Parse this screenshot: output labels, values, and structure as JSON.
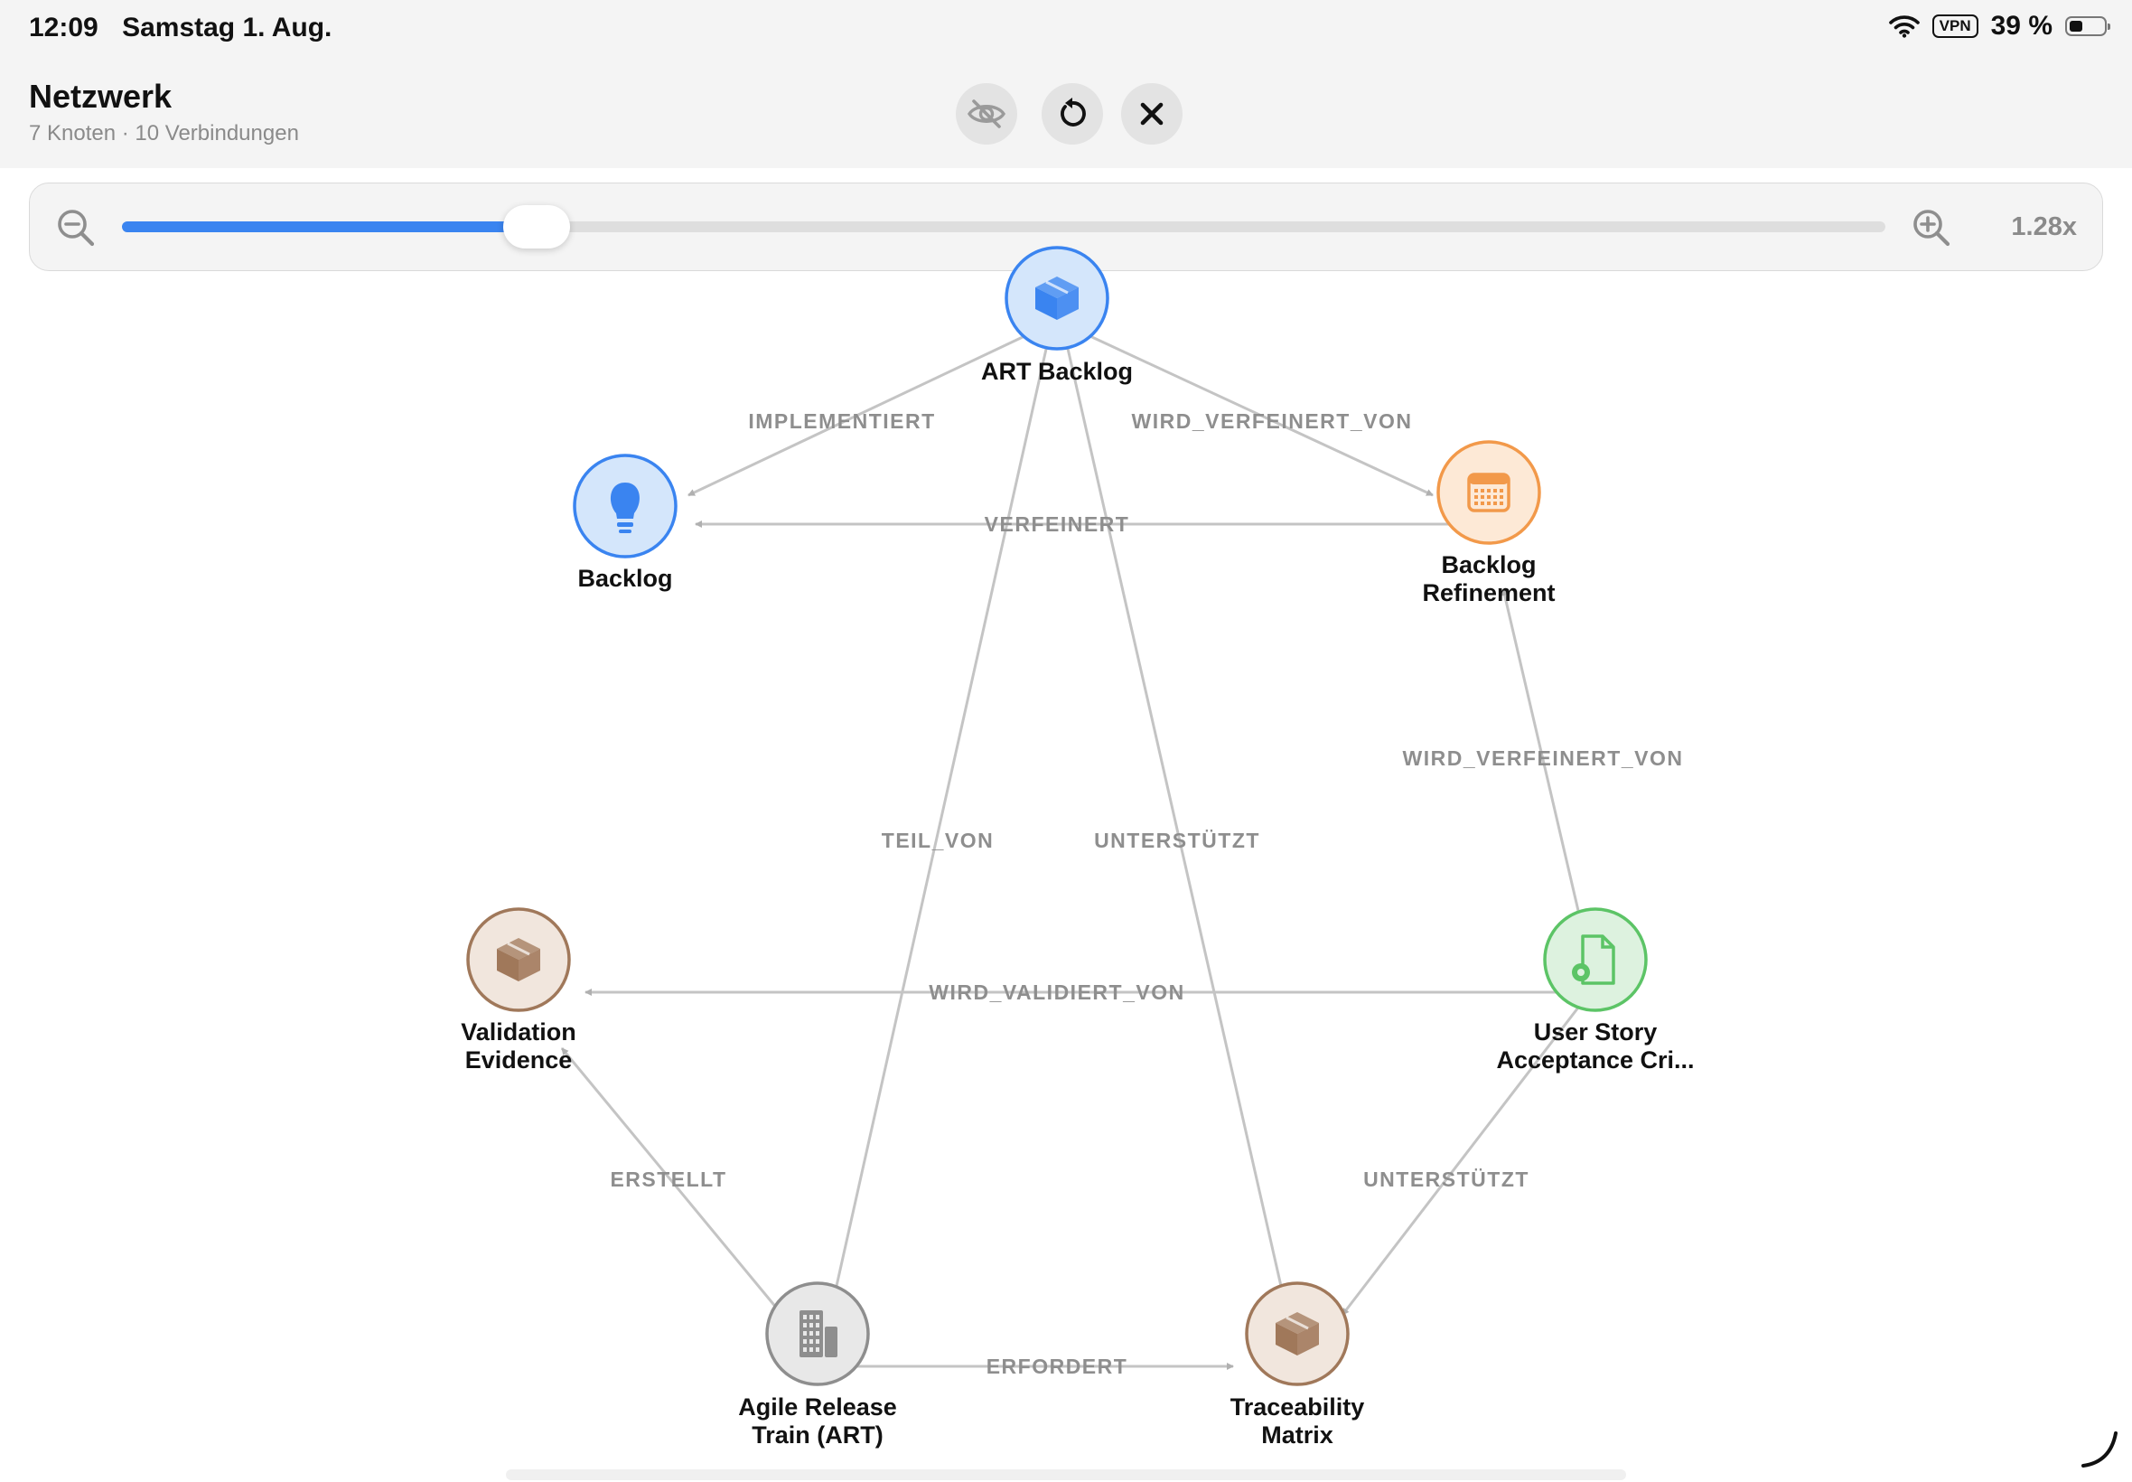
{
  "status_bar": {
    "time": "12:09",
    "date": "Samstag 1. Aug.",
    "vpn": "VPN",
    "battery": "39 %",
    "battery_level": 0.39
  },
  "header": {
    "title": "Netzwerk",
    "subtitle": "7 Knoten · 10 Verbindungen",
    "buttons": [
      "eye-slash-icon",
      "rotate-ccw-icon",
      "close-icon"
    ]
  },
  "zoom": {
    "value_label": "1.28x",
    "fraction": 0.235
  },
  "graph": {
    "nodes": [
      {
        "id": "art_backlog",
        "lines": [
          "ART Backlog"
        ],
        "icon": "cube-icon",
        "color": "#3a84f0",
        "fill": "#d4e6fb"
      },
      {
        "id": "backlog",
        "lines": [
          "Backlog"
        ],
        "icon": "lightbulb-icon",
        "color": "#3a84f0",
        "fill": "#d4e6fb"
      },
      {
        "id": "backlog_refinement",
        "lines": [
          "Backlog",
          "Refinement"
        ],
        "icon": "calendar-icon",
        "color": "#f2994a",
        "fill": "#fde9d6"
      },
      {
        "id": "validation_evidence",
        "lines": [
          "Validation",
          "Evidence"
        ],
        "icon": "box-icon",
        "color": "#a0785a",
        "fill": "#f1e6dd"
      },
      {
        "id": "user_story",
        "lines": [
          "User Story",
          "Acceptance Cri..."
        ],
        "icon": "doc-gear-icon",
        "color": "#5cc466",
        "fill": "#ddf2df"
      },
      {
        "id": "art",
        "lines": [
          "Agile Release",
          "Train (ART)"
        ],
        "icon": "building-icon",
        "color": "#8e8e8e",
        "fill": "#e8e8e8"
      },
      {
        "id": "traceability",
        "lines": [
          "Traceability",
          "Matrix"
        ],
        "icon": "box-icon",
        "color": "#a0785a",
        "fill": "#f1e6dd"
      }
    ],
    "edges": [
      {
        "from": "art_backlog",
        "to": "backlog",
        "label": "IMPLEMENTIERT"
      },
      {
        "from": "art_backlog",
        "to": "backlog_refinement",
        "label": "WIRD_VERFEINERT_VON"
      },
      {
        "from": "backlog_refinement",
        "to": "backlog",
        "label": "VERFEINERT"
      },
      {
        "from": "user_story",
        "to": "backlog_refinement",
        "label": "WIRD_VERFEINERT_VON"
      },
      {
        "from": "art_backlog",
        "to": "art",
        "label": "TEIL_VON"
      },
      {
        "from": "art_backlog",
        "to": "traceability",
        "label": "UNTERSTÜTZT"
      },
      {
        "from": "user_story",
        "to": "validation_evidence",
        "label": "WIRD_VALIDIERT_VON"
      },
      {
        "from": "art",
        "to": "validation_evidence",
        "label": "ERSTELLT"
      },
      {
        "from": "user_story",
        "to": "traceability",
        "label": "UNTERSTÜTZT"
      },
      {
        "from": "art",
        "to": "traceability",
        "label": "ERFORDERT"
      }
    ]
  }
}
